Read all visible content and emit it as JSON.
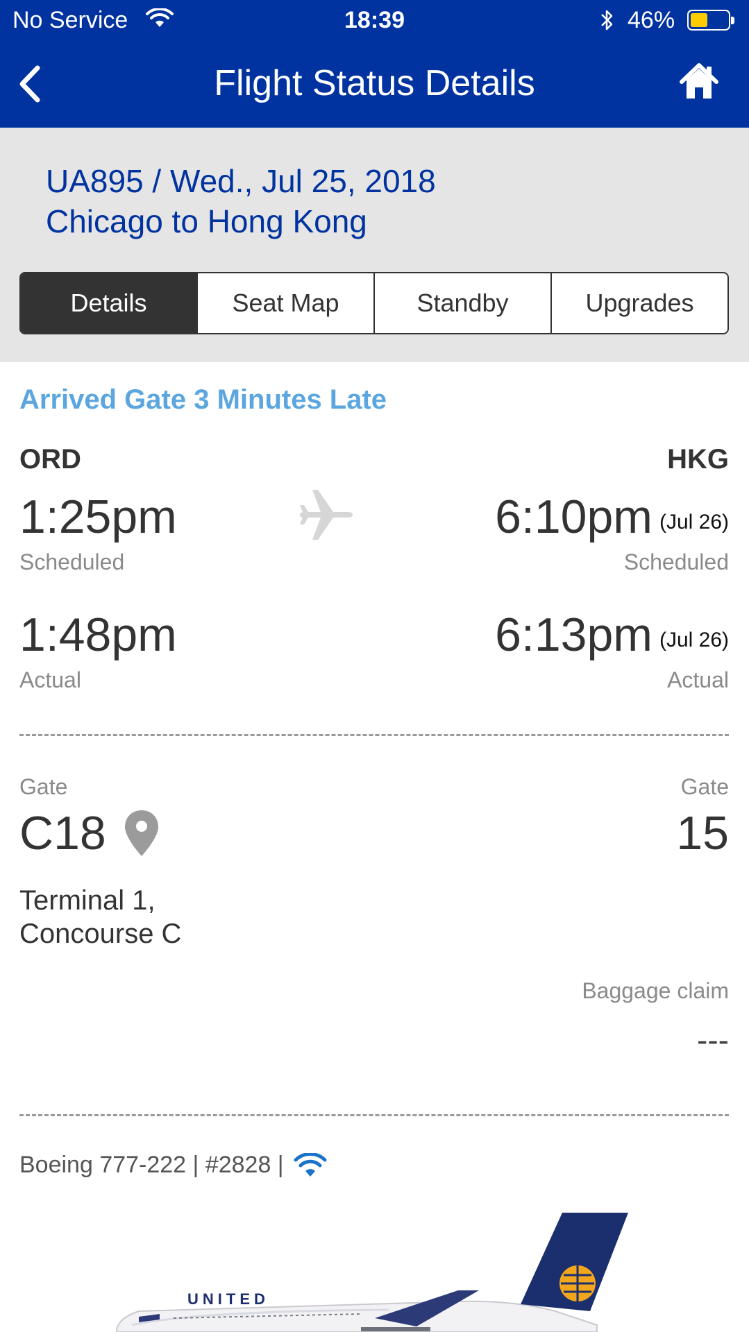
{
  "status_bar": {
    "carrier": "No Service",
    "time": "18:39",
    "battery_percent": "46%",
    "battery_level": 0.46,
    "icons": [
      "wifi-icon",
      "bluetooth-icon",
      "battery-icon"
    ]
  },
  "nav": {
    "title": "Flight Status Details",
    "back_icon": "chevron-left-icon",
    "home_icon": "home-icon"
  },
  "flight": {
    "number_date": "UA895 / Wed., Jul 25, 2018",
    "route": "Chicago to Hong Kong"
  },
  "tabs": [
    {
      "label": "Details",
      "active": true
    },
    {
      "label": "Seat Map",
      "active": false
    },
    {
      "label": "Standby",
      "active": false
    },
    {
      "label": "Upgrades",
      "active": false
    }
  ],
  "status": {
    "text": "Arrived Gate 3 Minutes Late",
    "color": "#5ca6e0"
  },
  "departure": {
    "code": "ORD",
    "scheduled_time": "1:25pm",
    "scheduled_label": "Scheduled",
    "actual_time": "1:48pm",
    "actual_label": "Actual",
    "gate_label": "Gate",
    "gate": "C18",
    "terminal_line1": "Terminal 1,",
    "terminal_line2": "Concourse C"
  },
  "arrival": {
    "code": "HKG",
    "scheduled_time": "6:10pm",
    "scheduled_date": "(Jul 26)",
    "scheduled_label": "Scheduled",
    "actual_time": "6:13pm",
    "actual_date": "(Jul 26)",
    "actual_label": "Actual",
    "gate_label": "Gate",
    "gate": "15",
    "baggage_label": "Baggage claim",
    "baggage_value": "---"
  },
  "aircraft": {
    "text": "Boeing 777-222 | #2828 |",
    "wifi_icon": "wifi-icon"
  },
  "plane_livery_text": "UNITED",
  "colors": {
    "brand_blue": "#0033a0",
    "header_gray": "#e5e5e5",
    "active_tab": "#333333",
    "battery_yellow": "#ffcc00",
    "wifi_blue": "#1a73c9"
  }
}
